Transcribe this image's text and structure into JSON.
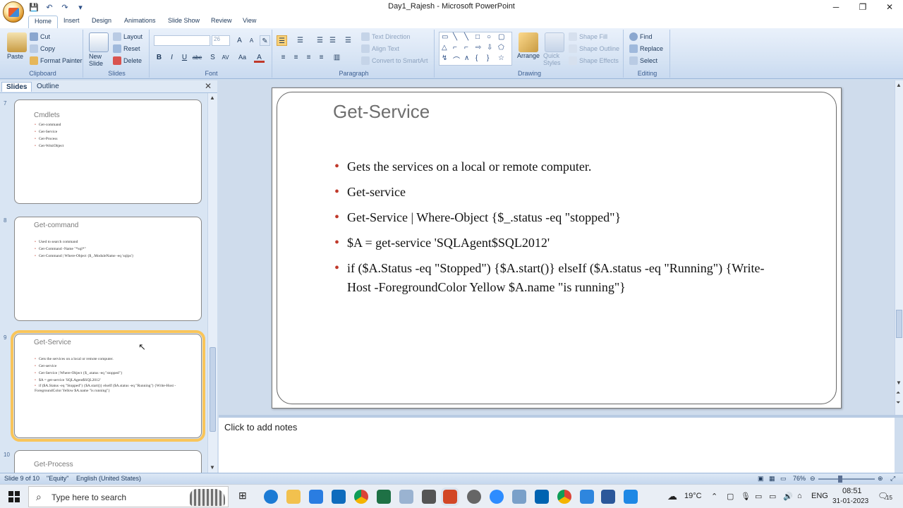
{
  "window": {
    "title": "Day1_Rajesh - Microsoft PowerPoint",
    "controls": [
      "─",
      "❐",
      "✕"
    ]
  },
  "quick_access": [
    "💾",
    "↶",
    "↷",
    "▾"
  ],
  "ribbon": {
    "tabs": [
      "Home",
      "Insert",
      "Design",
      "Animations",
      "Slide Show",
      "Review",
      "View"
    ],
    "clipboard": {
      "label": "Clipboard",
      "paste": "Paste",
      "cut": "Cut",
      "copy": "Copy",
      "format_painter": "Format Painter"
    },
    "slides": {
      "label": "Slides",
      "new_slide": "New\nSlide",
      "layout": "Layout",
      "reset": "Reset",
      "delete": "Delete"
    },
    "font": {
      "label": "Font",
      "font_size": "26",
      "bold": "B",
      "italic": "I",
      "underline": "U",
      "strike": "abe",
      "shadow": "S",
      "spacing": "AV",
      "case": "Aa",
      "color": "A"
    },
    "paragraph": {
      "label": "Paragraph",
      "text_direction": "Text Direction",
      "align_text": "Align Text",
      "convert_smartart": "Convert to SmartArt"
    },
    "drawing": {
      "label": "Drawing",
      "arrange": "Arrange",
      "quick_styles": "Quick\nStyles",
      "shape_fill": "Shape Fill",
      "shape_outline": "Shape Outline",
      "shape_effects": "Shape Effects"
    },
    "editing": {
      "label": "Editing",
      "find": "Find",
      "replace": "Replace",
      "select": "Select"
    }
  },
  "pane": {
    "tabs": [
      "Slides",
      "Outline"
    ],
    "close": "✕",
    "thumbnails": [
      {
        "num": "7",
        "title": "Cmdlets",
        "items": [
          "Get-command",
          "Get-Service",
          "Get-Process",
          "Get-WmiObject"
        ]
      },
      {
        "num": "8",
        "title": "Get-command",
        "items": [
          "Used to search command",
          "Get-Command -Name \"*sql*\"",
          "Get-Command | Where-Object {$_.ModuleName -eq 'sqlps'}"
        ]
      },
      {
        "num": "9",
        "title": "Get-Service",
        "items": [
          "Gets the services on a local or remote computer.",
          "Get-service",
          "Get-Service | Where-Object {$_.status -eq \"stopped\"}",
          "$A = get-service 'SQLAgent$SQL2012'",
          "if ($A.Status -eq \"Stopped\") {$A.start()} elseIf ($A.status -eq \"Running\") {Write-Host -ForegroundColor Yellow $A.name \"is running\"}"
        ]
      },
      {
        "num": "10",
        "title": "Get-Process",
        "items": []
      }
    ]
  },
  "slide": {
    "title": "Get-Service",
    "bullets": [
      " Gets the services on a local or remote computer.",
      "Get-service",
      " Get-Service | Where-Object {$_.status -eq \"stopped\"}",
      " $A = get-service 'SQLAgent$SQL2012'",
      "if ($A.Status -eq \"Stopped\") {$A.start()} elseIf ($A.status -eq \"Running\") {Write-Host -ForegroundColor Yellow $A.name \"is running\"}"
    ]
  },
  "notes": {
    "placeholder": "Click to add notes"
  },
  "status": {
    "slide": "Slide 9 of 10",
    "theme": "\"Equity\"",
    "language": "English (United States)",
    "zoom": "76%"
  },
  "taskbar": {
    "search_placeholder": "Type here to search",
    "weather": "19°C",
    "language": "ENG",
    "time": "08:51",
    "date": "31-01-2023",
    "notification_count": "15"
  },
  "colors": {
    "accent": "#1e395b",
    "bullet": "#c0392b",
    "selected_outline": "#f9c55a"
  }
}
